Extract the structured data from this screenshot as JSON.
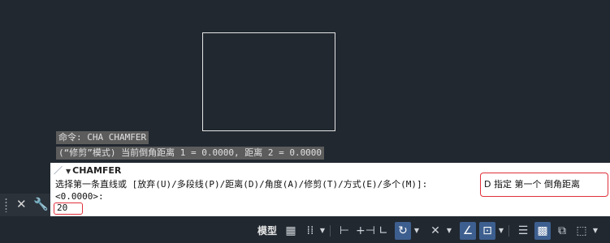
{
  "history": {
    "line1": "命令: CHA CHAMFER",
    "line2": "(“修剪”模式) 当前倒角距离 1 = 0.0000, 距离 2 = 0.0000"
  },
  "command_panel": {
    "command_name": "CHAMFER",
    "prompt_line1": "选择第一条直线或 [放弃(U)/多段线(P)/距离(D)/角度(A)/修剪(T)/方式(E)/多个(M)]:",
    "prompt_line2": "<0.0000>:",
    "input_value": "20",
    "hint_text": "D 指定 第一个 倒角距离"
  },
  "status_bar": {
    "model_label": "模型",
    "icons": [
      "grid-icon",
      "snap-dots-icon",
      "infer-constraint-icon",
      "dynamic-input-icon",
      "ortho-icon",
      "polar-tracking-icon",
      "isometric-icon",
      "object-snap-tracking-icon",
      "object-snap-icon",
      "lineweight-icon",
      "transparency-icon",
      "selection-cycling-icon",
      "3d-osnap-icon"
    ],
    "active_color": "#3d5f8f"
  },
  "colors": {
    "canvas_bg": "#212830",
    "highlight_border": "#e0303a"
  }
}
